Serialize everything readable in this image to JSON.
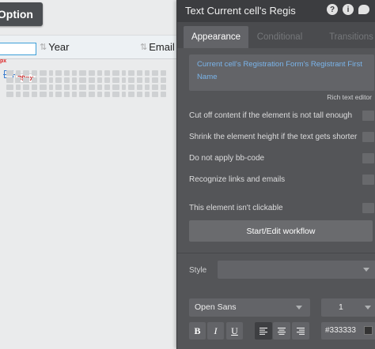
{
  "canvas": {
    "option_button": "Option",
    "columns": [
      {
        "label": "Year"
      },
      {
        "label": "Email"
      }
    ],
    "px_red": "px",
    "marker_label": "39px"
  },
  "panel": {
    "title": "Text Current cell's Regis",
    "icons": [
      "help-icon",
      "info-icon",
      "chat-icon"
    ],
    "tabs": [
      "Appearance",
      "Conditional",
      "Transitions"
    ],
    "active_tab": "Appearance",
    "content": "Current cell's Registration Form's Registrant First Name",
    "rich_text_label": "Rich text editor",
    "checkboxes": [
      {
        "label": "Cut off content if the element is not tall enough",
        "checked": false
      },
      {
        "label": "Shrink the element height if the text gets shorter",
        "checked": false
      },
      {
        "label": "Do not apply bb-code",
        "checked": false
      },
      {
        "label": "Recognize links and emails",
        "checked": false
      },
      {
        "label": "This element isn't clickable",
        "checked": false
      }
    ],
    "workflow_button": "Start/Edit workflow",
    "style_label": "Style",
    "style_value": "",
    "font": "Open Sans",
    "font_size": "1",
    "format": {
      "bold": "B",
      "italic": "I",
      "underline": "U"
    },
    "text_color": "#333333",
    "colors": {
      "panel_bg": "#545558",
      "header_bg": "#3c3d40",
      "link_text": "#7ab4ea",
      "selection": "#3d9fd8"
    }
  }
}
